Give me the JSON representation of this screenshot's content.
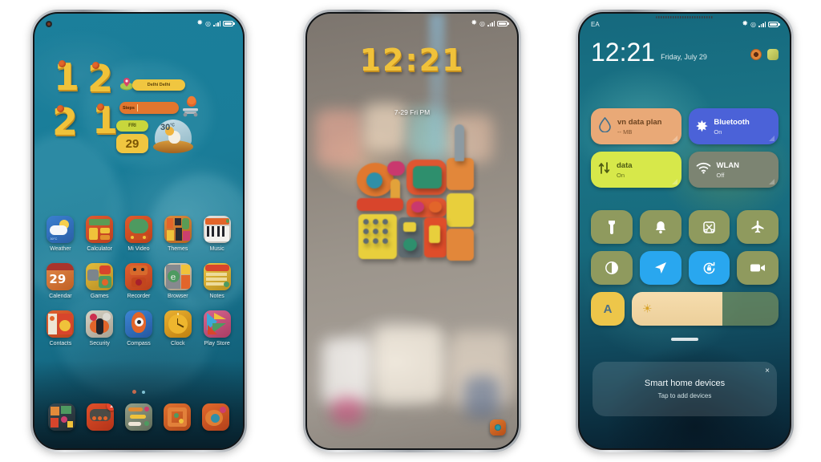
{
  "scene": {
    "background": "#ffffff",
    "phone_count": 3
  },
  "phone1": {
    "name": "home-screen",
    "status_bar": {
      "bluetooth": "bluetooth-icon",
      "alarm": "alarm-icon",
      "signal": "signal-icon",
      "battery": "battery-icon"
    },
    "clock_digits": [
      "1",
      "2",
      "2",
      "1"
    ],
    "widgets": {
      "location_label": "Delhi Delhi",
      "steps_label": "Steps",
      "calendar_weekday": "FRI",
      "calendar_day": "29",
      "weather_temp": "30",
      "weather_unit": "°C"
    },
    "apps": [
      [
        {
          "label": "Weather",
          "icon": "weather-icon"
        },
        {
          "label": "Calculator",
          "icon": "calculator-icon"
        },
        {
          "label": "Mi Video",
          "icon": "mi-video-icon"
        },
        {
          "label": "Themes",
          "icon": "themes-icon"
        },
        {
          "label": "Music",
          "icon": "music-icon"
        }
      ],
      [
        {
          "label": "Calendar",
          "icon": "calendar-icon"
        },
        {
          "label": "Games",
          "icon": "games-icon"
        },
        {
          "label": "Recorder",
          "icon": "recorder-icon"
        },
        {
          "label": "Browser",
          "icon": "browser-icon"
        },
        {
          "label": "Notes",
          "icon": "notes-icon"
        }
      ],
      [
        {
          "label": "Contacts",
          "icon": "contacts-icon"
        },
        {
          "label": "Security",
          "icon": "security-icon"
        },
        {
          "label": "Compass",
          "icon": "compass-icon"
        },
        {
          "label": "Clock",
          "icon": "clock-icon"
        },
        {
          "label": "Play Store",
          "icon": "play-store-icon"
        }
      ]
    ],
    "dock": [
      {
        "icon": "gallery-icon",
        "badge": ""
      },
      {
        "icon": "messages-icon",
        "badge": "1"
      },
      {
        "icon": "files-icon",
        "badge": ""
      },
      {
        "icon": "phone-icon",
        "badge": ""
      },
      {
        "icon": "camera-icon",
        "badge": ""
      }
    ],
    "page_indicator": {
      "active": 1,
      "total": 2
    }
  },
  "phone2": {
    "name": "lock-screen",
    "status_bar": {
      "bluetooth": "bluetooth-icon",
      "alarm": "alarm-icon",
      "signal": "signal-icon",
      "battery": "battery-icon"
    },
    "clock": "12:21",
    "date": "7-29 Fri PM",
    "camera_shortcut": "camera-shortcut-icon"
  },
  "phone3": {
    "name": "control-center",
    "carrier": "EA",
    "status_bar": {
      "bluetooth": "bluetooth-icon",
      "alarm": "alarm-icon",
      "signal": "signal-icon",
      "battery": "battery-icon"
    },
    "time": "12:21",
    "date": "Friday, July 29",
    "header_icons": [
      {
        "name": "user-profile-icon",
        "color": "#d1853c"
      },
      {
        "name": "settings-edit-icon",
        "color": "#cfd66a"
      }
    ],
    "tiles": [
      {
        "title": "vn data plan",
        "sub": "-- MB",
        "icon": "data-drop-icon",
        "bg": "#e9a977",
        "fg": "#6b4320"
      },
      {
        "title": "Bluetooth",
        "sub": "On",
        "icon": "bluetooth-icon",
        "bg": "#4b62d8",
        "fg": "#ffffff"
      },
      {
        "title": "data",
        "sub": "On",
        "icon": "mobile-data-icon",
        "bg": "#d7e84a",
        "fg": "#4d5a12"
      },
      {
        "title": "WLAN",
        "sub": "Off",
        "icon": "wifi-icon",
        "bg": "#7c8472",
        "fg": "#ffffff"
      }
    ],
    "mini_toggles": [
      {
        "name": "flashlight-icon",
        "glyph": "flashlight",
        "active": false
      },
      {
        "name": "silent-bell-icon",
        "glyph": "bell",
        "active": false
      },
      {
        "name": "screenshot-icon",
        "glyph": "scissors",
        "active": false
      },
      {
        "name": "airplane-mode-icon",
        "glyph": "airplane",
        "active": false
      },
      {
        "name": "dark-mode-icon",
        "glyph": "contrast",
        "active": false
      },
      {
        "name": "location-icon",
        "glyph": "navigate",
        "active": true
      },
      {
        "name": "auto-rotate-icon",
        "glyph": "rotate-lock",
        "active": true
      },
      {
        "name": "screen-recorder-icon",
        "glyph": "camcorder",
        "active": false
      }
    ],
    "auto_brightness_label": "A",
    "brightness_value": 62,
    "brightness_icon": "sun-icon",
    "smart_home": {
      "title": "Smart home devices",
      "subtitle": "Tap to add devices",
      "close": "×"
    },
    "colors": {
      "active_tile": "#29a7ef",
      "inactive_tile": "#8f9a5e",
      "accent": "#edc64a"
    }
  }
}
